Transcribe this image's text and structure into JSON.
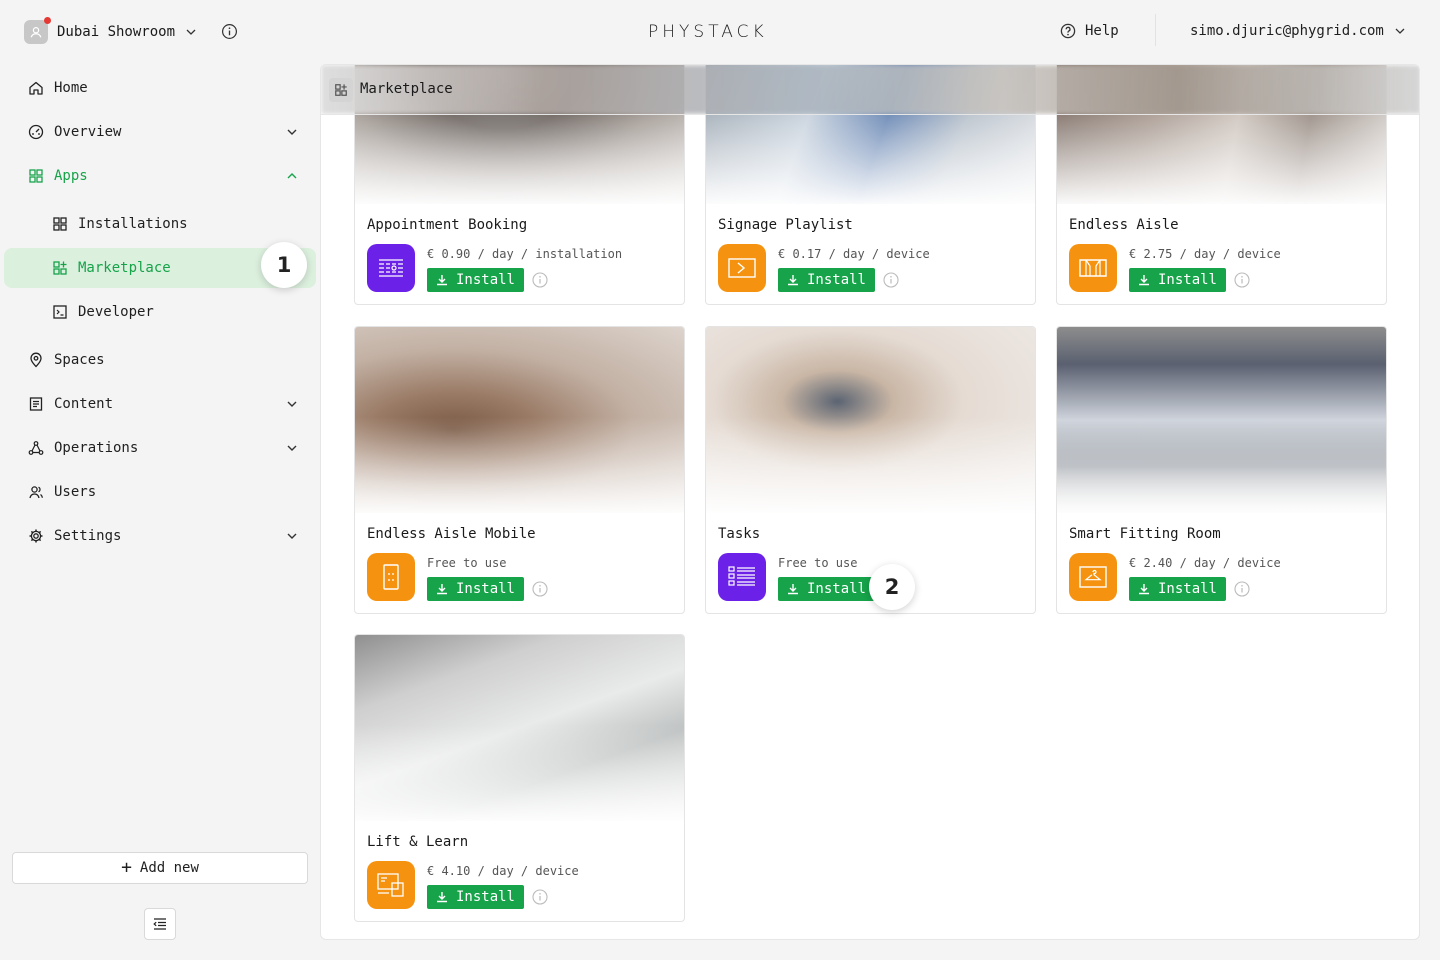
{
  "topbar": {
    "workspace_name": "Dubai Showroom",
    "logo_text": "PHYSTACK",
    "help_label": "Help",
    "user_email": "simo.djuric@phygrid.com"
  },
  "sidebar": {
    "items": [
      {
        "label": "Home",
        "icon": "home-icon"
      },
      {
        "label": "Overview",
        "icon": "gauge-icon"
      },
      {
        "label": "Apps",
        "icon": "apps-grid-icon"
      },
      {
        "label": "Installations",
        "icon": "grid-icon"
      },
      {
        "label": "Marketplace",
        "icon": "grid-plus-icon"
      },
      {
        "label": "Developer",
        "icon": "terminal-icon"
      },
      {
        "label": "Spaces",
        "icon": "location-pin-icon"
      },
      {
        "label": "Content",
        "icon": "document-icon"
      },
      {
        "label": "Operations",
        "icon": "network-icon"
      },
      {
        "label": "Users",
        "icon": "users-icon"
      },
      {
        "label": "Settings",
        "icon": "gear-icon"
      }
    ],
    "step1": "1",
    "add_new_label": "Add new"
  },
  "main": {
    "title": "Marketplace",
    "step2": "2",
    "install_label": "Install",
    "cards": [
      {
        "title": "Appointment Booking",
        "price": "€ 0.90 / day / installation",
        "icon": "calendar-icon",
        "color": "#6b21e8"
      },
      {
        "title": "Signage Playlist",
        "price": "€ 0.17 / day / device",
        "icon": "play-screen-icon",
        "color": "#f59310"
      },
      {
        "title": "Endless Aisle",
        "price": "€ 2.75 / day / device",
        "icon": "aisle-icon",
        "color": "#f59310"
      },
      {
        "title": "Endless Aisle Mobile",
        "price": "Free to use",
        "icon": "mobile-icon",
        "color": "#f59310"
      },
      {
        "title": "Tasks",
        "price": "Free to use",
        "icon": "task-list-icon",
        "color": "#6b21e8"
      },
      {
        "title": "Smart Fitting Room",
        "price": "€ 2.40 / day / device",
        "icon": "hanger-icon",
        "color": "#f59310"
      },
      {
        "title": "Lift & Learn",
        "price": "€ 4.10 / day / device",
        "icon": "screens-icon",
        "color": "#f59310"
      }
    ]
  }
}
